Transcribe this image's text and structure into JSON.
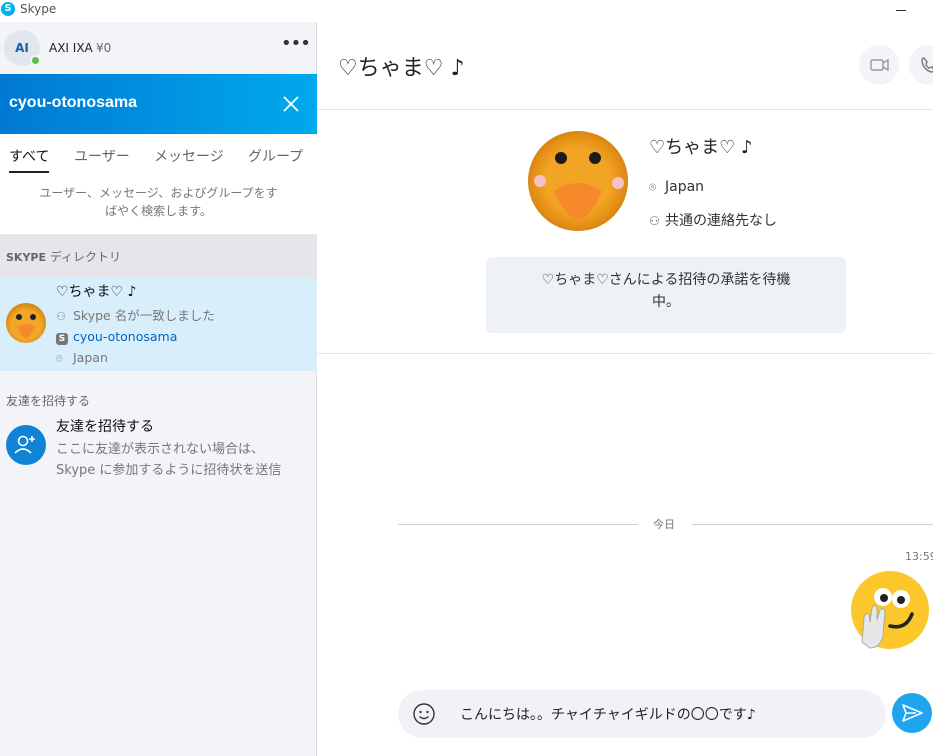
{
  "window": {
    "title": "Skype",
    "logo_letter": "S"
  },
  "profile": {
    "initials": "AI",
    "name": "AXI IXA",
    "balance": "¥0",
    "more": "•••"
  },
  "search": {
    "query": "cyou-otonosama"
  },
  "tabs": [
    {
      "label": "すべて",
      "active": true
    },
    {
      "label": "ユーザー"
    },
    {
      "label": "メッセージ"
    },
    {
      "label": "グループ"
    }
  ],
  "search_hint": {
    "line1": "ユーザー、メッセージ、およびグループをす",
    "line2": "ばやく検索します。"
  },
  "directory": {
    "header_bold": "SKYPE",
    "header_rest": " ディレクトリ"
  },
  "result": {
    "name": "♡ちゃま♡ ♪",
    "match": "Skype 名が一致しました",
    "skype_id": "cyou-otonosama",
    "location": "Japan"
  },
  "invite_section": {
    "header": "友達を招待する",
    "title": "友達を招待する",
    "desc_line1": "ここに友達が表示されない場合は、",
    "desc_line2": "Skype に参加するように招待状を送信"
  },
  "chat": {
    "title": "♡ちゃま♡ ♪",
    "contact_name": "♡ちゃま♡ ♪",
    "location": "Japan",
    "mutual": "共通の連絡先なし",
    "pending_line1": "♡ちゃま♡さんによる招待の承諾を待機",
    "pending_line2": "中。",
    "day_divider": "今日",
    "message_time": "13:59",
    "composer_text": "こんにちは。。チャイチャイギルドの〇〇です♪"
  },
  "colors": {
    "accent": "#0079d3",
    "accent_light": "#00a9ec",
    "selected_row": "#d9eefb",
    "presence": "#5cc146"
  }
}
